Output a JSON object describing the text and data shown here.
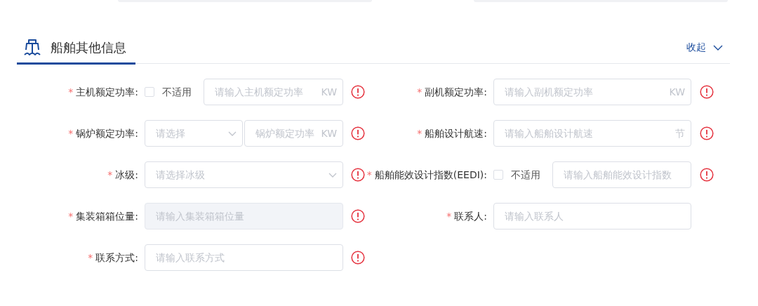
{
  "section": {
    "title": "船舶其他信息",
    "toggle": "收起"
  },
  "rows": [
    [
      {
        "kind": "checkbox-input",
        "required_mark": "*",
        "label": "主机额定功率:",
        "checkbox_label": "不适用",
        "checked": false,
        "placeholder": "请输入主机额定功率",
        "suffix": "KW",
        "error": true
      },
      {
        "kind": "input",
        "required_mark": "*",
        "label": "副机额定功率:",
        "placeholder": "请输入副机额定功率",
        "suffix": "KW",
        "error": true
      }
    ],
    [
      {
        "kind": "select-input",
        "required_mark": "*",
        "label": "锅炉额定功率:",
        "select_placeholder": "请选择",
        "placeholder": "锅炉额定功率",
        "suffix": "KW",
        "error": true
      },
      {
        "kind": "input",
        "required_mark": "*",
        "label": "船舶设计航速:",
        "placeholder": "请输入船舶设计航速",
        "suffix": "节",
        "error": true
      }
    ],
    [
      {
        "kind": "select",
        "required_mark": "*",
        "label": "冰级:",
        "placeholder": "请选择冰级",
        "error": true
      },
      {
        "kind": "checkbox-input",
        "required_mark": "*",
        "label": "船舶能效设计指数(EEDI):",
        "checkbox_label": "不适用",
        "checked": false,
        "placeholder": "请输入船舶能效设计指数",
        "error": true
      }
    ],
    [
      {
        "kind": "input",
        "required_mark": "*",
        "label": "集装箱箱位量:",
        "placeholder": "请输入集装箱箱位量",
        "disabled": true,
        "error": true
      },
      {
        "kind": "input",
        "required_mark": "*",
        "label": "联系人:",
        "placeholder": "请输入联系人",
        "error": false
      }
    ],
    [
      {
        "kind": "input",
        "required_mark": "*",
        "label": "联系方式:",
        "placeholder": "请输入联系方式",
        "error": true
      }
    ]
  ]
}
